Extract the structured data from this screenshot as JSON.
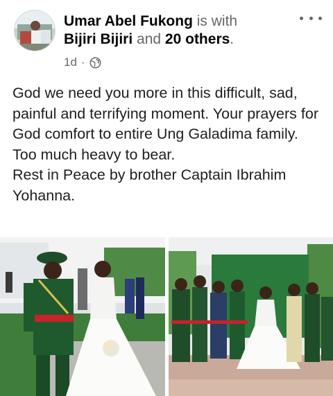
{
  "post": {
    "author": "Umar Abel Fukong",
    "with_text": "is with",
    "tagged_person": "Bijiri Bijiri",
    "and_text": "and",
    "others": "20 others",
    "period": ".",
    "time": "1d",
    "separator": "·",
    "privacy_icon": "globe-icon",
    "more_icon": "more-horizontal-icon",
    "body_paragraphs": [
      "God we need you more in this difficult, sad, painful and terrifying moment. Your prayers for God comfort to entire Ung Galadima family. Too much heavy to bear.",
      "Rest in Peace by brother Captain Ibrahim Yohanna."
    ]
  },
  "photos": [
    {
      "description_icon": "wedding-couple-photo"
    },
    {
      "description_icon": "wedding-group-photo"
    }
  ],
  "colors": {
    "text": "#1c1e21",
    "muted": "#65676b",
    "uniform_green": "#1f5a2e",
    "sash_red": "#c8222a"
  }
}
